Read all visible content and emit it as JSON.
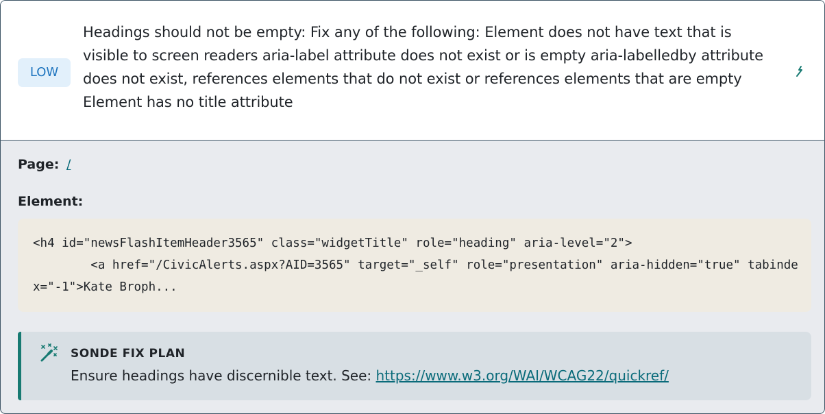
{
  "issue": {
    "severity": "LOW",
    "description": "Headings should not be empty: Fix any of the following: Element does not have text that is visible to screen readers aria-label attribute does not exist or is empty aria-labelledby attribute does not exist, references elements that do not exist or references elements that are empty Element has no title attribute"
  },
  "details": {
    "page_label": "Page:",
    "page_value": "/",
    "element_label": "Element:",
    "element_code": "<h4 id=\"newsFlashItemHeader3565\" class=\"widgetTitle\" role=\"heading\" aria-level=\"2\">\n        <a href=\"/CivicAlerts.aspx?AID=3565\" target=\"_self\" role=\"presentation\" aria-hidden=\"true\" tabindex=\"-1\">Kate Broph..."
  },
  "fix_plan": {
    "title": "SONDE FIX PLAN",
    "text": "Ensure headings have discernible text. See: ",
    "link": "https://www.w3.org/WAI/WCAG22/quickref/"
  },
  "colors": {
    "accent": "#177a72",
    "badge_bg": "#e2f0fb",
    "badge_text": "#1f75bf",
    "link": "#0a6b7a"
  }
}
